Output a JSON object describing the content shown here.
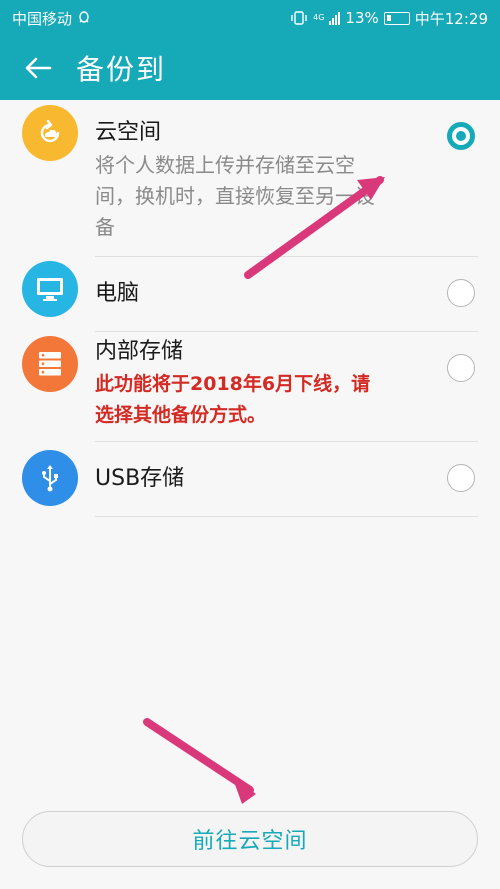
{
  "status_bar": {
    "carrier": "中国移动",
    "battery": "13%",
    "time": "中午12:29",
    "network": "4G"
  },
  "app_bar": {
    "title": "备份到",
    "back_icon": "arrow-left-icon"
  },
  "options": [
    {
      "label": "云空间",
      "description": [
        "将个人数据上传并存储至云空",
        "间，换机时，直接恢复至另一设",
        "备"
      ],
      "icon": "cloud-sync-icon",
      "icon_color": "#f8b931",
      "selected": true
    },
    {
      "label": "电脑",
      "icon": "monitor-icon",
      "icon_color": "#27b6e3",
      "selected": false
    },
    {
      "label": "内部存储",
      "warning": [
        "此功能将于2018年6月下线，请",
        "选择其他备份方式。"
      ],
      "icon": "storage-icon",
      "icon_color": "#f4773a",
      "selected": false
    },
    {
      "label": "USB存储",
      "icon": "usb-icon",
      "icon_color": "#2e8ee8",
      "selected": false
    }
  ],
  "cloud_button": {
    "label": "前往云空间"
  },
  "colors": {
    "accent": "#16a9b8",
    "warning": "#d32b24",
    "annotation_arrow": "#d9397a"
  }
}
